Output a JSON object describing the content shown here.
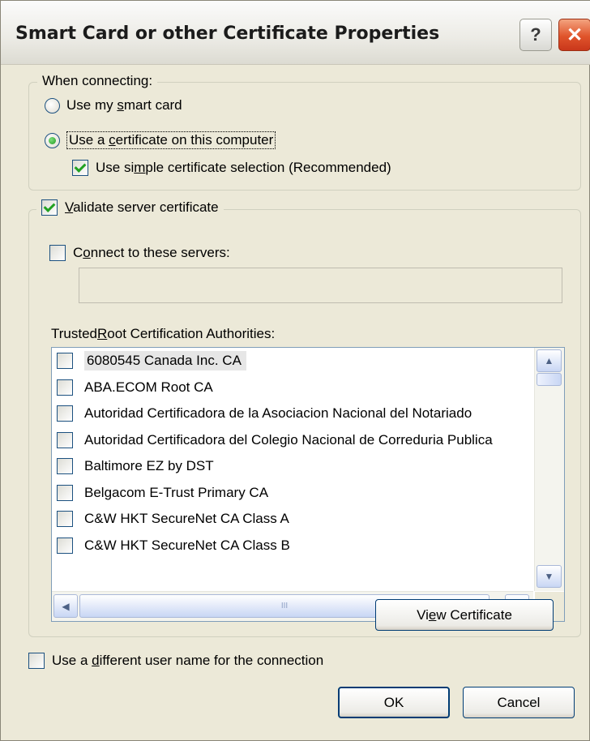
{
  "window": {
    "title": "Smart Card or other Certificate Properties",
    "help_label": "?",
    "close_label": "✕"
  },
  "when_connecting": {
    "legend": "When connecting:",
    "smartcard_radio": {
      "pre": "Use my ",
      "key": "s",
      "post": "mart card",
      "selected": false
    },
    "certificate_radio": {
      "pre": "Use a ",
      "key": "c",
      "post": "ertificate on this computer",
      "selected": true
    },
    "simple_selection": {
      "pre": "Use si",
      "key": "m",
      "post": "ple certificate selection (Recommended)",
      "checked": true
    }
  },
  "validate": {
    "label_key": "V",
    "label_post": "alidate server certificate",
    "checked": true,
    "connect_servers": {
      "pre": "C",
      "key": "o",
      "post": "nnect to these servers:",
      "checked": false
    },
    "servers_value": "",
    "trusted_root": {
      "pre": "Trusted ",
      "key": "R",
      "post": "oot Certification Authorities:"
    },
    "authorities": [
      "6080545 Canada Inc. CA",
      "ABA.ECOM Root CA",
      "Autoridad Certificadora de la Asociacion Nacional del Notariado",
      "Autoridad Certificadora del Colegio Nacional de Correduria Publica",
      "Baltimore EZ by DST",
      "Belgacom E-Trust Primary CA",
      "C&W HKT SecureNet CA Class A",
      "C&W HKT SecureNet CA Class B"
    ],
    "scroll": {
      "up": "▲",
      "down": "▼",
      "left": "◀",
      "right": "▶",
      "grip": "III"
    },
    "view_certificate": {
      "pre": "Vi",
      "key": "e",
      "post": "w Certificate"
    }
  },
  "different_user": {
    "pre": "Use a ",
    "key": "d",
    "post": "ifferent user name for the connection",
    "checked": false
  },
  "buttons": {
    "ok": "OK",
    "cancel": "Cancel"
  }
}
